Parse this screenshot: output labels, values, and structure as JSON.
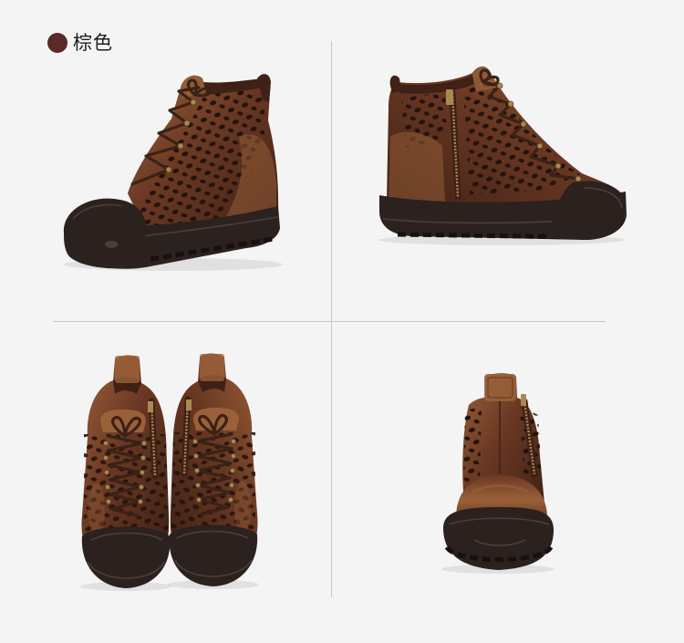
{
  "color_option": {
    "label": "棕色"
  },
  "colors": {
    "background": "#f4f4f4",
    "swatch": "#5a2a26",
    "text": "#1e1e1e",
    "divider": "#c6c6c6",
    "leather": "#6a3823",
    "leather_dark": "#3f2116",
    "leather_highlight": "#9a6139",
    "sole": "#2b211e",
    "perforation": "#23130e",
    "lace": "#3b2217",
    "hardware": "#a9894f"
  }
}
